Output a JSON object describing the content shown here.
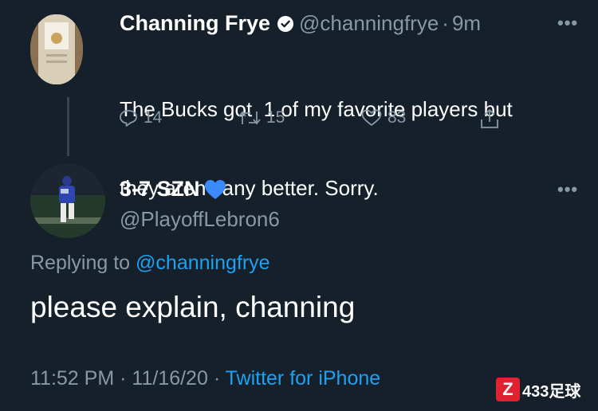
{
  "tweet": {
    "name": "Channing Frye",
    "handle": "@channingfrye",
    "separator": "·",
    "time": "9m",
    "text_line1": "The Bucks got  1 of my favorite players but",
    "text_line2": "they aren’t any better. Sorry.",
    "replies": "14",
    "retweets": "15",
    "likes": "83",
    "more": "•••"
  },
  "reply": {
    "name": "3-7 SZN",
    "emoji": "💙",
    "handle": "@PlayoffLebron6",
    "more": "•••",
    "replying_prefix": "Replying to ",
    "replying_to": "@channingfrye",
    "text": "please explain, channing",
    "time": "11:52 PM",
    "sep1": "·",
    "date": "11/16/20",
    "sep2": "·",
    "source": "Twitter for iPhone"
  },
  "watermark": {
    "badge": "Z",
    "text": "433足球"
  },
  "colors": {
    "background": "#15202b",
    "muted": "#8899a6",
    "link": "#1da1f2",
    "heart_emoji": "#3b8bff"
  },
  "icons": [
    "verified-badge-icon",
    "reply-icon",
    "retweet-icon",
    "like-icon",
    "share-icon",
    "more-icon"
  ]
}
